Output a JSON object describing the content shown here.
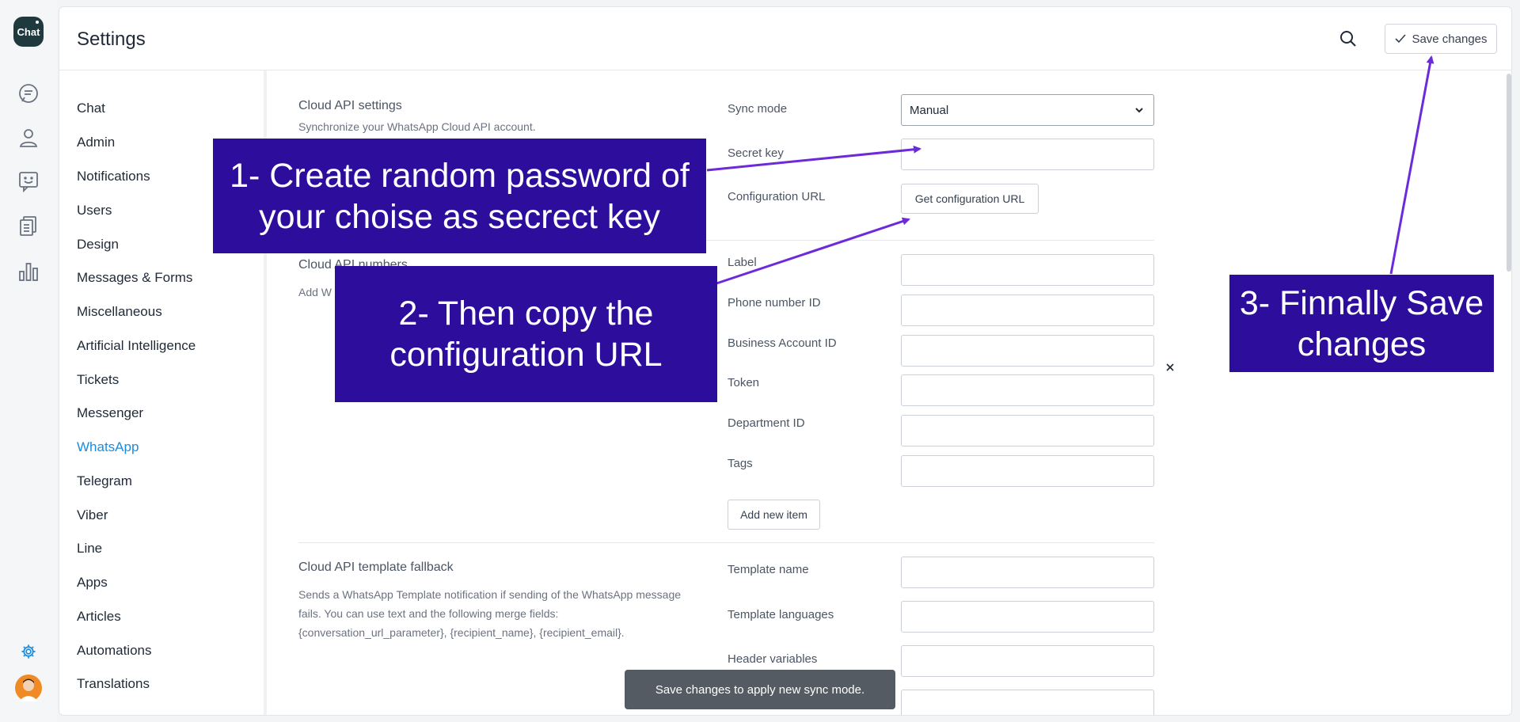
{
  "app": {
    "logo_text": "Chat"
  },
  "rail": {
    "icons": [
      "chat-bubble-icon",
      "user-icon",
      "smiley-message-icon",
      "documents-icon",
      "bar-chart-icon",
      "gear-icon",
      "avatar"
    ]
  },
  "header": {
    "title": "Settings",
    "save_label": "Save changes"
  },
  "nav": {
    "items": [
      "Chat",
      "Admin",
      "Notifications",
      "Users",
      "Design",
      "Messages & Forms",
      "Miscellaneous",
      "Artificial Intelligence",
      "Tickets",
      "Messenger",
      "WhatsApp",
      "Telegram",
      "Viber",
      "Line",
      "Apps",
      "Articles",
      "Automations",
      "Translations"
    ],
    "active": "WhatsApp"
  },
  "cloud_api_settings": {
    "title": "Cloud API settings",
    "description": "Synchronize your WhatsApp Cloud API account.",
    "sync_mode_label": "Sync mode",
    "sync_mode_value": "Manual",
    "secret_key_label": "Secret key",
    "secret_key_value": "",
    "configuration_url_label": "Configuration URL",
    "configuration_url_button": "Get configuration URL"
  },
  "cloud_api_numbers": {
    "title": "Cloud API numbers",
    "description_visible": "Add W",
    "fields": [
      "Label",
      "Phone number ID",
      "Business Account ID",
      "Token",
      "Department ID",
      "Tags"
    ],
    "add_button": "Add new item"
  },
  "template_fallback": {
    "title": "Cloud API template fallback",
    "description": "Sends a WhatsApp Template notification if sending of the WhatsApp message fails. You can use text and the following merge fields: {conversation_url_parameter}, {recipient_name}, {recipient_email}.",
    "fields": [
      "Template name",
      "Template languages",
      "Header variables"
    ]
  },
  "toast": {
    "text": "Save changes to apply new sync mode."
  },
  "annotations": {
    "step1": "1- Create random password of your choise as secrect key",
    "step2": "2- Then copy the configuration URL",
    "step3": "3- Finnally Save changes",
    "color": "#2d0d9c",
    "arrow_color": "#6c2bd9"
  }
}
